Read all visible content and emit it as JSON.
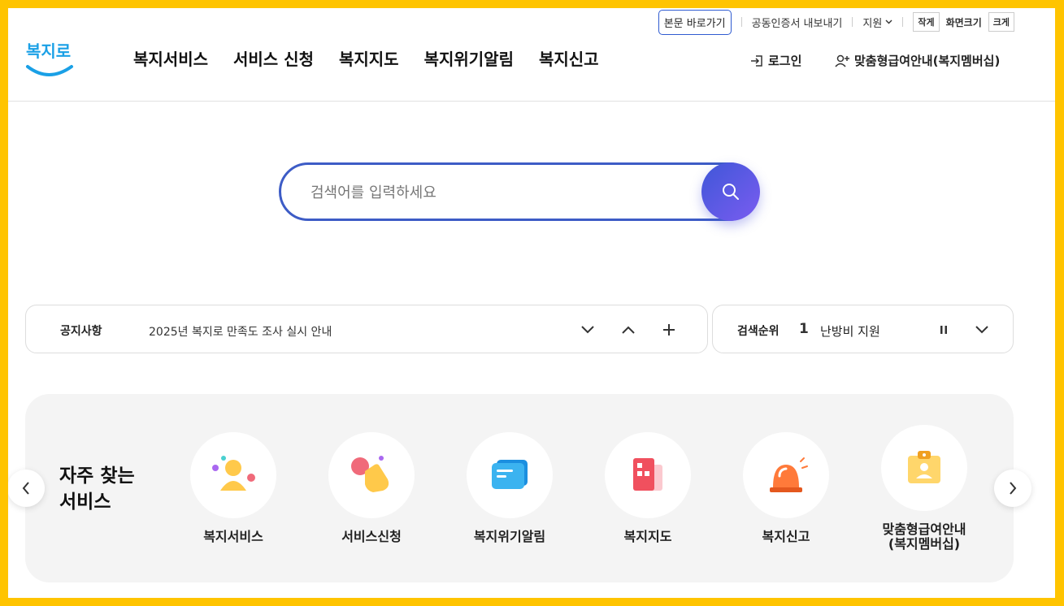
{
  "utility": {
    "skip_link": "본문 바로가기",
    "cert_export": "공동인증서 내보내기",
    "support": "지원",
    "font_small": "작게",
    "font_size_label": "화면크기",
    "font_large": "크게"
  },
  "logo": {
    "text": "복지로"
  },
  "nav": {
    "items": [
      "복지서비스",
      "서비스 신청",
      "복지지도",
      "복지위기알림",
      "복지신고"
    ]
  },
  "auth": {
    "login": "로그인",
    "membership": "맞춤형급여안내(복지멤버십)"
  },
  "search": {
    "placeholder": "검색어를 입력하세요",
    "value": ""
  },
  "notice": {
    "label": "공지사항",
    "text": "2025년 복지로 만족도 조사 실시 안내"
  },
  "ranking": {
    "label": "검색순위",
    "rank": "1",
    "keyword": "난방비 지원"
  },
  "frequent": {
    "title_line1": "자주 찾는",
    "title_line2": "서비스",
    "items": [
      {
        "label": "복지서비스",
        "icon": "person-icon"
      },
      {
        "label": "서비스신청",
        "icon": "hand-tap-icon"
      },
      {
        "label": "복지위기알림",
        "icon": "chat-bubble-icon"
      },
      {
        "label": "복지지도",
        "icon": "map-building-icon"
      },
      {
        "label": "복지신고",
        "icon": "siren-icon"
      },
      {
        "label": "맞춤형급여안내",
        "label2": "(복지멤버십)",
        "icon": "id-badge-icon"
      }
    ]
  },
  "colors": {
    "frame": "#FFC400",
    "accent": "#3d5cc6",
    "logo_blue": "#1aa0e6"
  }
}
